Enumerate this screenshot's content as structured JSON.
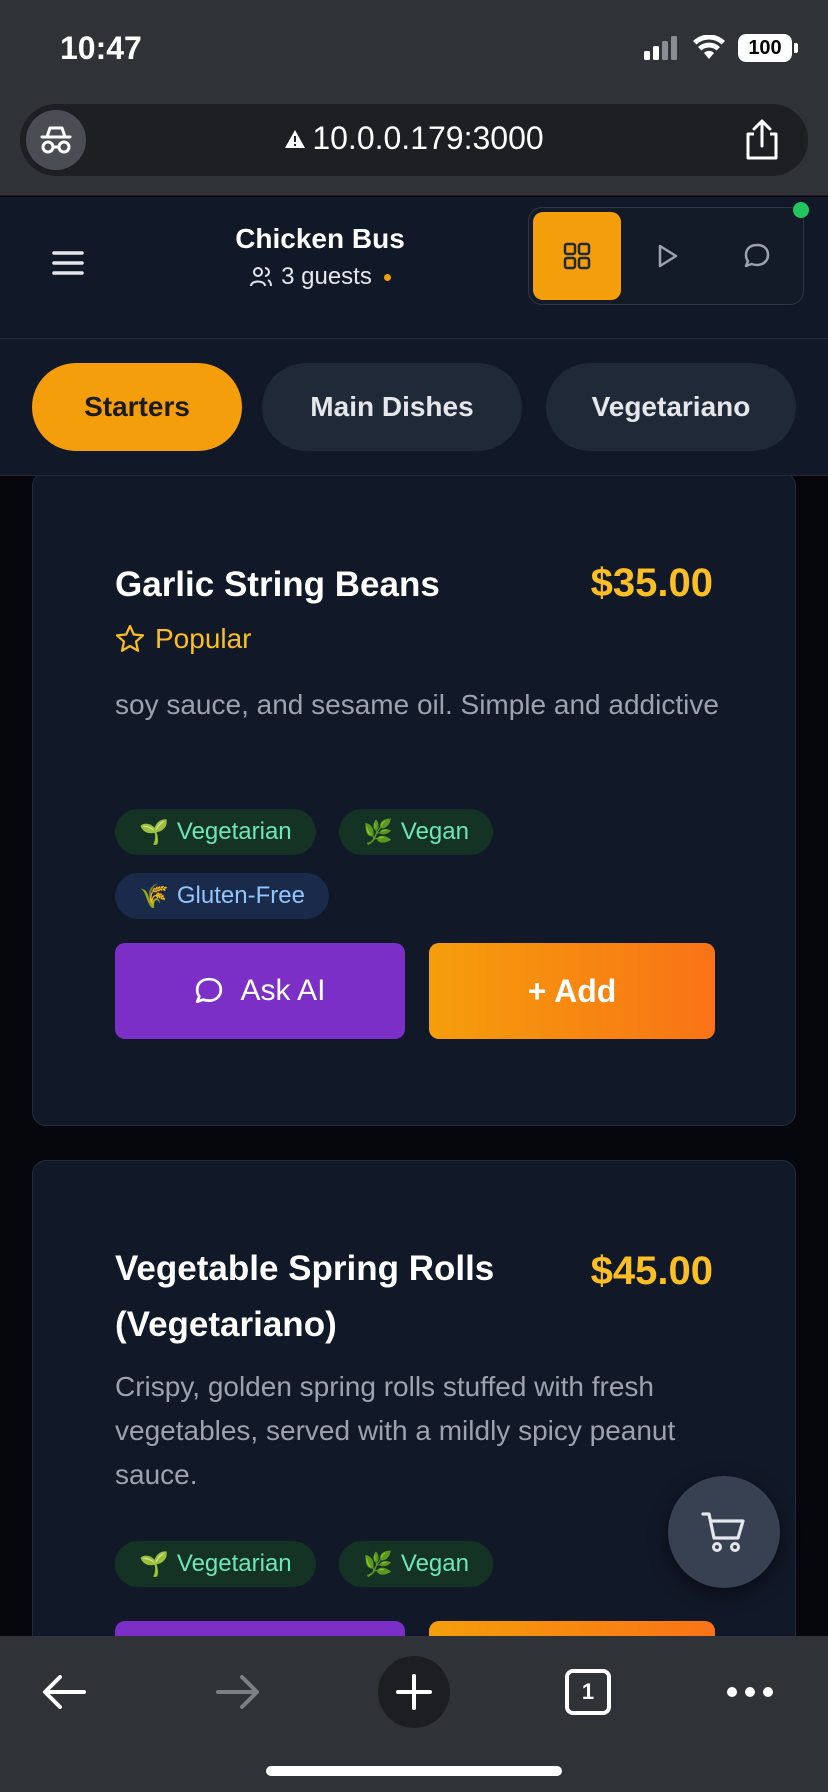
{
  "status_bar": {
    "time": "10:47",
    "battery": "100"
  },
  "browser": {
    "url": "10.0.0.179:3000",
    "tab_count": "1"
  },
  "header": {
    "title": "Chicken Bus",
    "guests": "3 guests"
  },
  "categories": [
    {
      "label": "Starters",
      "active": true
    },
    {
      "label": "Main Dishes",
      "active": false
    },
    {
      "label": "Vegetariano",
      "active": false
    }
  ],
  "dishes": [
    {
      "name": "Garlic String Beans",
      "price": "$35.00",
      "badge": "Popular",
      "description": "soy sauce, and sesame oil. Simple and addictive",
      "tags": [
        {
          "icon": "🌱",
          "label": "Vegetarian"
        },
        {
          "icon": "🌿",
          "label": "Vegan"
        },
        {
          "icon": "🌾",
          "label": "Gluten-Free"
        }
      ],
      "ask_label": "Ask AI",
      "add_label": "+ Add"
    },
    {
      "name_line1": "Vegetable Spring Rolls",
      "name_line2": "(Vegetariano)",
      "price": "$45.00",
      "description": "Crispy, golden spring rolls stuffed with fresh vegetables, served with a mildly spicy peanut sauce.",
      "tags": [
        {
          "icon": "🌱",
          "label": "Vegetarian"
        },
        {
          "icon": "🌿",
          "label": "Vegan"
        }
      ]
    }
  ],
  "colors": {
    "accent": "#f59e0b",
    "price": "#fbbf24",
    "ai_button": "#7b2fc7",
    "online": "#22c55e"
  }
}
